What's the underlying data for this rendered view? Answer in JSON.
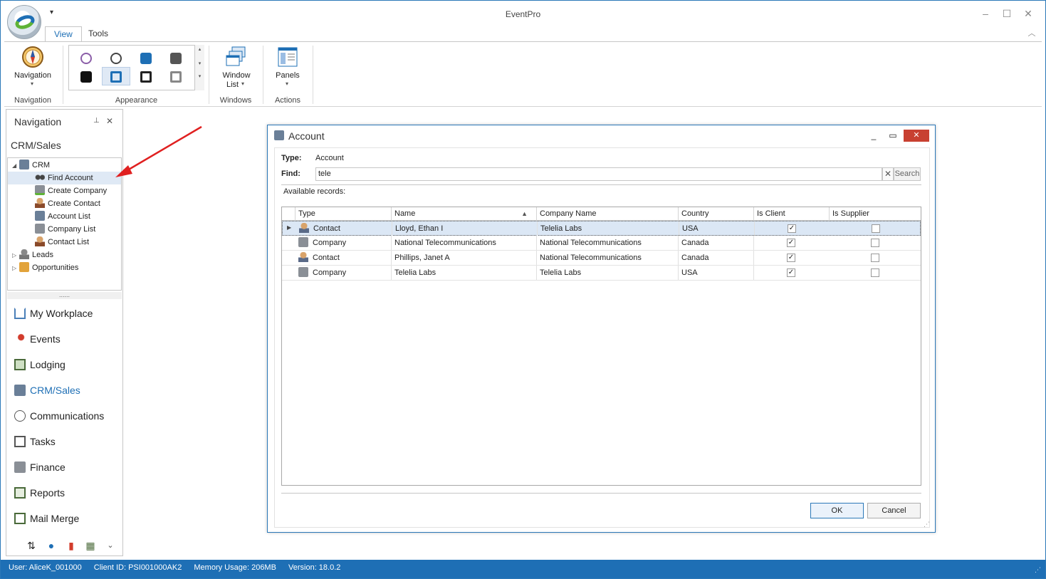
{
  "app": {
    "title": "EventPro",
    "qat_label": "▾",
    "tabs": [
      "View",
      "Tools"
    ]
  },
  "ribbon": {
    "navigation_label": "Navigation",
    "navigation_group": "Navigation",
    "appearance_group": "Appearance",
    "window_list_label_1": "Window",
    "window_list_label_2": "List",
    "windows_group": "Windows",
    "panels_label": "Panels",
    "actions_group": "Actions"
  },
  "nav": {
    "title": "Navigation",
    "section": "CRM/Sales",
    "tree": [
      {
        "label": "CRM",
        "icon": "crm-icon",
        "level": 0,
        "expanded": true
      },
      {
        "label": "Find Account",
        "icon": "binoculars-icon",
        "level": 1,
        "selected": true
      },
      {
        "label": "Create Company",
        "icon": "create-company-icon",
        "level": 1
      },
      {
        "label": "Create Contact",
        "icon": "create-contact-icon",
        "level": 1
      },
      {
        "label": "Account List",
        "icon": "account-list-icon",
        "level": 1
      },
      {
        "label": "Company List",
        "icon": "company-list-icon",
        "level": 1
      },
      {
        "label": "Contact List",
        "icon": "contact-list-icon",
        "level": 1
      },
      {
        "label": "Leads",
        "icon": "leads-icon",
        "level": 0
      },
      {
        "label": "Opportunities",
        "icon": "opportunities-icon",
        "level": 0
      }
    ],
    "splitter": "......",
    "links": [
      {
        "label": "My Workplace",
        "icon": "home-icon"
      },
      {
        "label": "Events",
        "icon": "events-pin-icon"
      },
      {
        "label": "Lodging",
        "icon": "lodging-icon"
      },
      {
        "label": "CRM/Sales",
        "icon": "crm-sales-icon",
        "active": true
      },
      {
        "label": "Communications",
        "icon": "speech-bubble-icon"
      },
      {
        "label": "Tasks",
        "icon": "clipboard-icon"
      },
      {
        "label": "Finance",
        "icon": "calculator-icon"
      },
      {
        "label": "Reports",
        "icon": "reports-icon"
      },
      {
        "label": "Mail Merge",
        "icon": "mail-merge-icon"
      }
    ]
  },
  "dialog": {
    "title": "Account",
    "type_label": "Type:",
    "type_value": "Account",
    "find_label": "Find:",
    "find_value": "tele",
    "search_label": "Search",
    "available_label": "Available records:",
    "columns": [
      "Type",
      "Name",
      "Company Name",
      "Country",
      "Is Client",
      "Is Supplier"
    ],
    "rows": [
      {
        "type": "Contact",
        "name": "Lloyd, Ethan I",
        "company": "Telelia Labs",
        "country": "USA",
        "is_client": true,
        "is_supplier": false
      },
      {
        "type": "Company",
        "name": "National Telecommunications",
        "company": "National Telecommunications",
        "country": "Canada",
        "is_client": true,
        "is_supplier": false
      },
      {
        "type": "Contact",
        "name": "Phillips, Janet A",
        "company": "National Telecommunications",
        "country": "Canada",
        "is_client": true,
        "is_supplier": false
      },
      {
        "type": "Company",
        "name": "Telelia Labs",
        "company": "Telelia Labs",
        "country": "USA",
        "is_client": true,
        "is_supplier": false
      }
    ],
    "ok_label": "OK",
    "cancel_label": "Cancel"
  },
  "status": {
    "user": "User: AliceK_001000",
    "client": "Client ID: PSI001000AK2",
    "memory": "Memory Usage: 206MB",
    "version": "Version: 18.0.2"
  },
  "colors": {
    "accent": "#1e6fb5",
    "close": "#c84031",
    "selection": "#dbe7f5",
    "annotation_arrow": "#e02020"
  }
}
